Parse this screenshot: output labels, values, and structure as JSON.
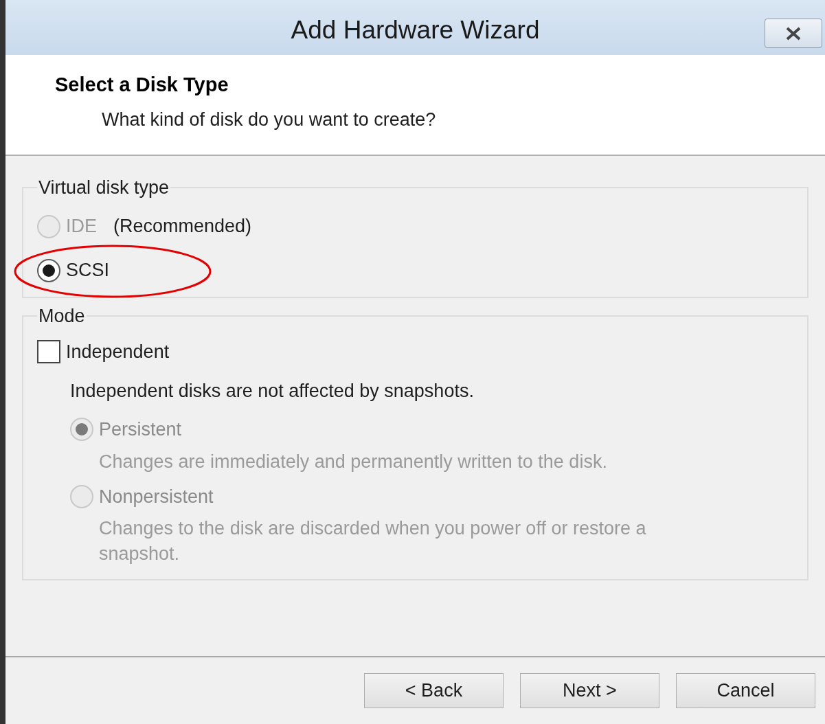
{
  "window": {
    "title": "Add Hardware Wizard"
  },
  "header": {
    "title": "Select a Disk Type",
    "subtitle": "What kind of disk do you want to create?"
  },
  "disk_type_group": {
    "legend": "Virtual disk type",
    "options": [
      {
        "label": "IDE",
        "note": "(Recommended)",
        "selected": false,
        "disabled": true,
        "highlighted": false
      },
      {
        "label": "SCSI",
        "selected": true,
        "disabled": false,
        "highlighted": true
      }
    ]
  },
  "mode_group": {
    "legend": "Mode",
    "independent": {
      "label": "Independent",
      "checked": false
    },
    "info": "Independent disks are not affected by snapshots.",
    "options": [
      {
        "label": "Persistent",
        "description": "Changes are immediately and permanently written to the disk.",
        "selected": true,
        "disabled": true
      },
      {
        "label": "Nonpersistent",
        "description": "Changes to the disk are discarded when you power off or restore a snapshot.",
        "selected": false,
        "disabled": true
      }
    ]
  },
  "buttons": [
    {
      "label": "< Back"
    },
    {
      "label": "Next >"
    },
    {
      "label": "Cancel"
    }
  ]
}
